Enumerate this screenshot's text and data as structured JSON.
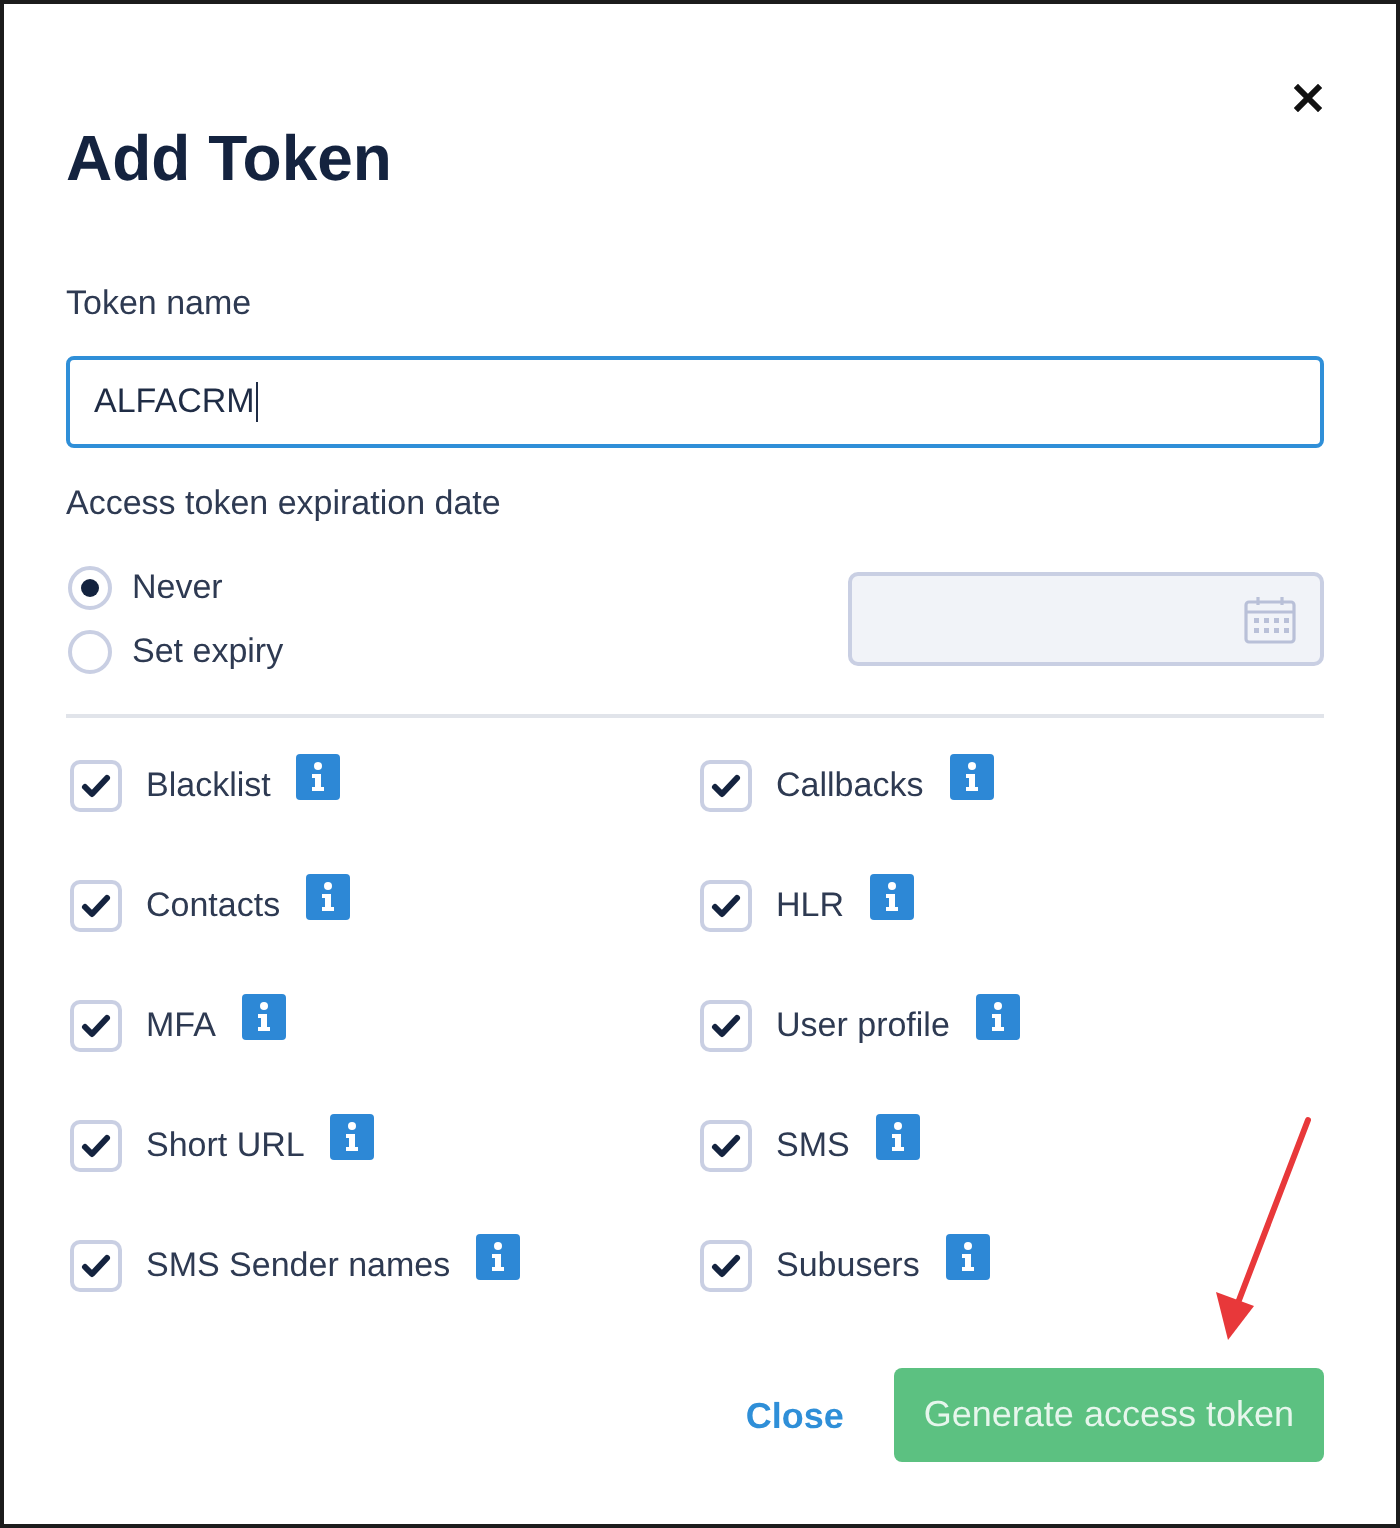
{
  "dialog": {
    "title": "Add Token"
  },
  "token_name": {
    "label": "Token name",
    "value": "ALFACRM",
    "focused": true
  },
  "expiration": {
    "label": "Access token expiration date",
    "options": [
      {
        "label": "Never",
        "selected": true
      },
      {
        "label": "Set expiry",
        "selected": false
      }
    ],
    "date_field": {
      "disabled": true
    }
  },
  "permissions": [
    {
      "label": "Blacklist",
      "checked": true
    },
    {
      "label": "Callbacks",
      "checked": true
    },
    {
      "label": "Contacts",
      "checked": true
    },
    {
      "label": "HLR",
      "checked": true
    },
    {
      "label": "MFA",
      "checked": true
    },
    {
      "label": "User profile",
      "checked": true
    },
    {
      "label": "Short URL",
      "checked": true
    },
    {
      "label": "SMS",
      "checked": true
    },
    {
      "label": "SMS Sender names",
      "checked": true
    },
    {
      "label": "Subusers",
      "checked": true
    }
  ],
  "buttons": [
    {
      "label": "Close",
      "kind": "link"
    },
    {
      "label": "Generate access token",
      "kind": "primary"
    }
  ]
}
